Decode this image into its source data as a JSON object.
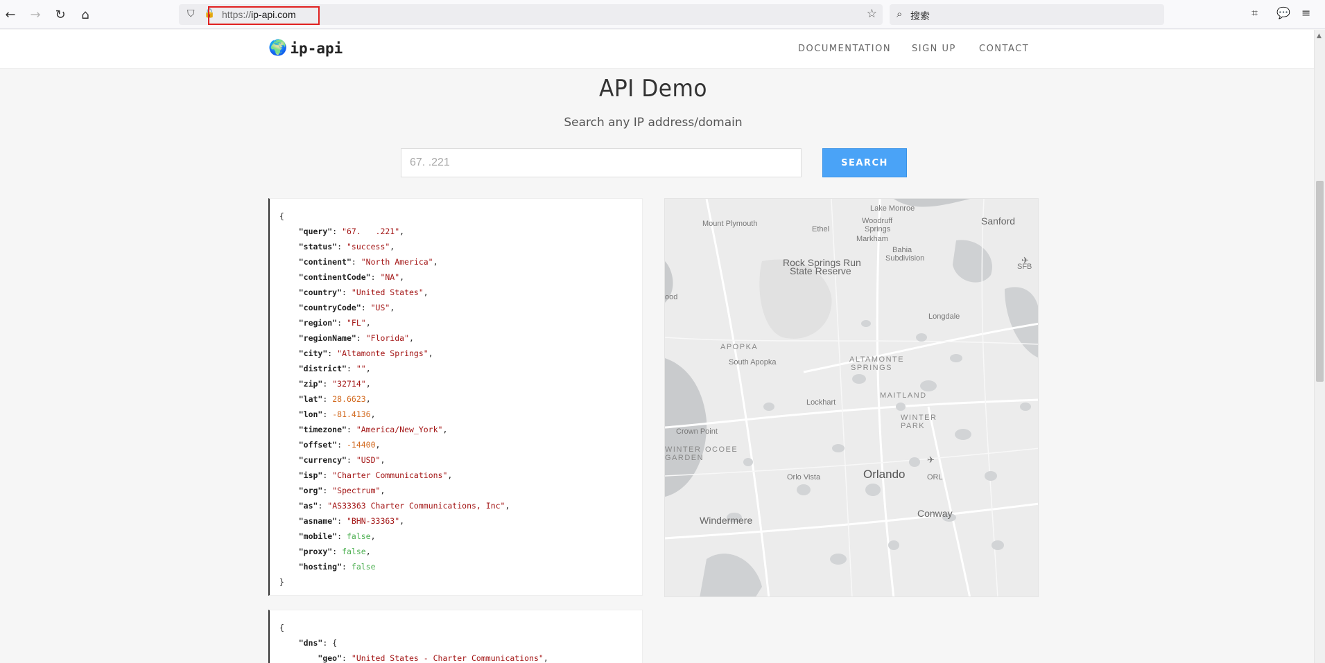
{
  "browser": {
    "url_scheme": "https://",
    "url_host": "ip-api.com",
    "search_placeholder": "搜索"
  },
  "site": {
    "logo_text": "ip-api",
    "nav": [
      "DOCUMENTATION",
      "SIGN UP",
      "CONTACT"
    ]
  },
  "demo": {
    "title": "API Demo",
    "subtitle": "Search any IP address/domain",
    "ip_value": "67.   .221",
    "search_label": "SEARCH"
  },
  "result": [
    {
      "key": "query",
      "value": "\"67.   .221\"",
      "type": "s"
    },
    {
      "key": "status",
      "value": "\"success\"",
      "type": "s"
    },
    {
      "key": "continent",
      "value": "\"North America\"",
      "type": "s"
    },
    {
      "key": "continentCode",
      "value": "\"NA\"",
      "type": "s"
    },
    {
      "key": "country",
      "value": "\"United States\"",
      "type": "s"
    },
    {
      "key": "countryCode",
      "value": "\"US\"",
      "type": "s"
    },
    {
      "key": "region",
      "value": "\"FL\"",
      "type": "s"
    },
    {
      "key": "regionName",
      "value": "\"Florida\"",
      "type": "s"
    },
    {
      "key": "city",
      "value": "\"Altamonte Springs\"",
      "type": "s"
    },
    {
      "key": "district",
      "value": "\"\"",
      "type": "s"
    },
    {
      "key": "zip",
      "value": "\"32714\"",
      "type": "s"
    },
    {
      "key": "lat",
      "value": "28.6623",
      "type": "n"
    },
    {
      "key": "lon",
      "value": "-81.4136",
      "type": "n"
    },
    {
      "key": "timezone",
      "value": "\"America/New_York\"",
      "type": "s"
    },
    {
      "key": "offset",
      "value": "-14400",
      "type": "n"
    },
    {
      "key": "currency",
      "value": "\"USD\"",
      "type": "s"
    },
    {
      "key": "isp",
      "value": "\"Charter Communications\"",
      "type": "s"
    },
    {
      "key": "org",
      "value": "\"Spectrum\"",
      "type": "s"
    },
    {
      "key": "as",
      "value": "\"AS33363 Charter Communications, Inc\"",
      "type": "s"
    },
    {
      "key": "asname",
      "value": "\"BHN-33363\"",
      "type": "s"
    },
    {
      "key": "mobile",
      "value": "false",
      "type": "b"
    },
    {
      "key": "proxy",
      "value": "false",
      "type": "b"
    },
    {
      "key": "hosting",
      "value": "false",
      "type": "b"
    }
  ],
  "dns": {
    "key": "dns",
    "geo_key": "geo",
    "geo_value": "\"United States - Charter Communications\""
  },
  "map_labels": [
    {
      "text": "Lake Monroe",
      "cls": ""
    },
    {
      "text": "Sanford",
      "cls": "mid"
    },
    {
      "text": "Woodruff",
      "cls": ""
    },
    {
      "text": "Springs",
      "cls": ""
    },
    {
      "text": "Mount Plymouth",
      "cls": ""
    },
    {
      "text": "Ethel",
      "cls": ""
    },
    {
      "text": "Markham",
      "cls": ""
    },
    {
      "text": "Bahia",
      "cls": ""
    },
    {
      "text": "Subdivision",
      "cls": ""
    },
    {
      "text": "SFB",
      "cls": ""
    },
    {
      "text": "Rock Springs Run",
      "cls": "mid"
    },
    {
      "text": "State Reserve",
      "cls": "mid"
    },
    {
      "text": "ood",
      "cls": ""
    },
    {
      "text": "Longdale",
      "cls": ""
    },
    {
      "text": "APOPKA",
      "cls": "caps"
    },
    {
      "text": "South Apopka",
      "cls": ""
    },
    {
      "text": "ALTAMONTE",
      "cls": "caps"
    },
    {
      "text": "SPRINGS",
      "cls": "caps"
    },
    {
      "text": "MAITLAND",
      "cls": "caps"
    },
    {
      "text": "Lockhart",
      "cls": ""
    },
    {
      "text": "WINTER",
      "cls": "caps"
    },
    {
      "text": "PARK",
      "cls": "caps"
    },
    {
      "text": "Crown Point",
      "cls": ""
    },
    {
      "text": "WINTER",
      "cls": "caps"
    },
    {
      "text": "GARDEN",
      "cls": "caps"
    },
    {
      "text": "OCOEE",
      "cls": "caps"
    },
    {
      "text": "Orlo Vista",
      "cls": ""
    },
    {
      "text": "Orlando",
      "cls": "big"
    },
    {
      "text": "ORL",
      "cls": ""
    },
    {
      "text": "Conway",
      "cls": "mid"
    },
    {
      "text": "Windermere",
      "cls": "mid"
    }
  ]
}
